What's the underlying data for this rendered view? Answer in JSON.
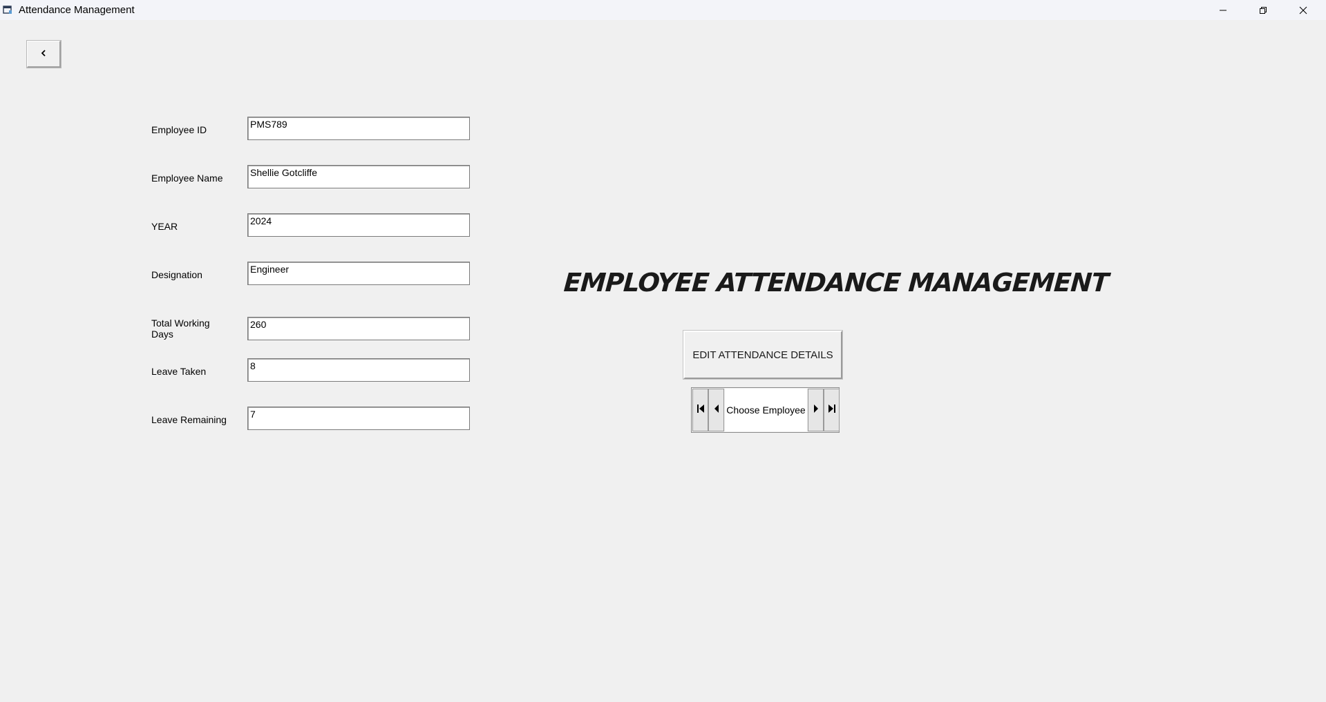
{
  "window": {
    "title": "Attendance Management",
    "icons": {
      "app": "app-window-icon",
      "minimize": "minimize-icon",
      "restore": "restore-icon",
      "close": "close-icon",
      "back": "chevron-left-icon"
    }
  },
  "form": {
    "employee_id": {
      "label": "Employee ID",
      "value": "PMS789"
    },
    "employee_name": {
      "label": "Employee Name",
      "value": "Shellie Gotcliffe"
    },
    "year": {
      "label": "YEAR",
      "value": "2024"
    },
    "designation": {
      "label": "Designation",
      "value": "Engineer"
    },
    "total_working_days": {
      "label_line1": "Total Working",
      "label_line2": "Days",
      "value": "260"
    },
    "leave_taken": {
      "label": "Leave Taken",
      "value": "8"
    },
    "leave_remaining": {
      "label": "Leave Remaining",
      "value": "7"
    }
  },
  "main": {
    "heading": "EMPLOYEE ATTENDANCE MANAGEMENT",
    "edit_button": "EDIT ATTENDANCE DETAILS",
    "navigator": {
      "caption": "Choose Employee",
      "icons": [
        "first-record-icon",
        "previous-record-icon",
        "next-record-icon",
        "last-record-icon"
      ]
    }
  }
}
